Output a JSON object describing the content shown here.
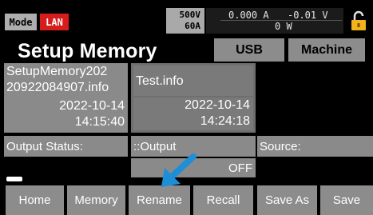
{
  "status": {
    "mode": "Mode",
    "lan": "LAN",
    "rating_voltage": "500V",
    "rating_current": "60A",
    "current": "0.000 A",
    "voltage": "-0.01 V",
    "power": "0 W",
    "lock_icon": "lock-icon",
    "lan_color": "#d71c1c",
    "lock_color": "#f2b21c"
  },
  "header": {
    "title": "Setup Memory",
    "usb_label": "USB",
    "machine_label": "Machine"
  },
  "files": [
    {
      "name_line1": "SetupMemory202",
      "name_line2": "20922084907.info",
      "date": "2022-10-14",
      "time": "14:15:40"
    },
    {
      "name_line1": "Test.info",
      "name_line2": "",
      "date": "2022-10-14",
      "time": "14:24:18"
    }
  ],
  "details": {
    "output_status_label": "Output Status:",
    "output_label": "::Output",
    "output_value": "OFF",
    "source_label": "Source:"
  },
  "buttons": {
    "home": "Home",
    "memory": "Memory",
    "rename": "Rename",
    "recall": "Recall",
    "save_as": "Save As",
    "save": "Save"
  },
  "annotation": {
    "arrow_color": "#1e8fd6",
    "arrow_icon": "pointer-arrow-icon"
  }
}
